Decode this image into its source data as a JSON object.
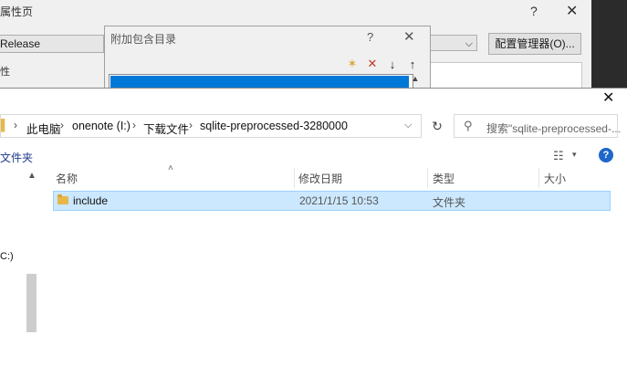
{
  "property_dialog": {
    "title": "属性页",
    "help": "?",
    "close": "✕",
    "configuration": "Release",
    "config_manager_button": "配置管理器(O)...",
    "side_label": "性"
  },
  "include_dialog": {
    "title": "附加包含目录",
    "help": "?",
    "close": "✕",
    "toolbar": {
      "new_folder": "✶",
      "delete": "✕",
      "move_down": "↓",
      "move_up": "↑"
    }
  },
  "file_dialog": {
    "close": "✕",
    "breadcrumb": [
      "此电脑",
      "onenote (I:)",
      "下载文件",
      "sqlite-preprocessed-3280000"
    ],
    "search_placeholder": "搜索\"sqlite-preprocessed-...",
    "new_folder_label": "文件夹",
    "nav_item": "C:)",
    "columns": {
      "name": "名称",
      "modified": "修改日期",
      "type": "类型",
      "size": "大小"
    },
    "rows": [
      {
        "name": "include",
        "modified": "2021/1/15 10:53",
        "type": "文件夹",
        "size": ""
      }
    ]
  },
  "colors": {
    "selection_blue": "#0078d7",
    "row_highlight": "#cce8ff",
    "folder_yellow": "#e8b74a",
    "help_blue": "#1e66c9"
  },
  "icons": [
    "folder-icon",
    "search-icon",
    "refresh-icon",
    "view-icon",
    "help-icon",
    "close-icon",
    "new-folder-icon",
    "delete-icon",
    "arrow-down-icon",
    "arrow-up-icon",
    "chevron-down-icon"
  ]
}
